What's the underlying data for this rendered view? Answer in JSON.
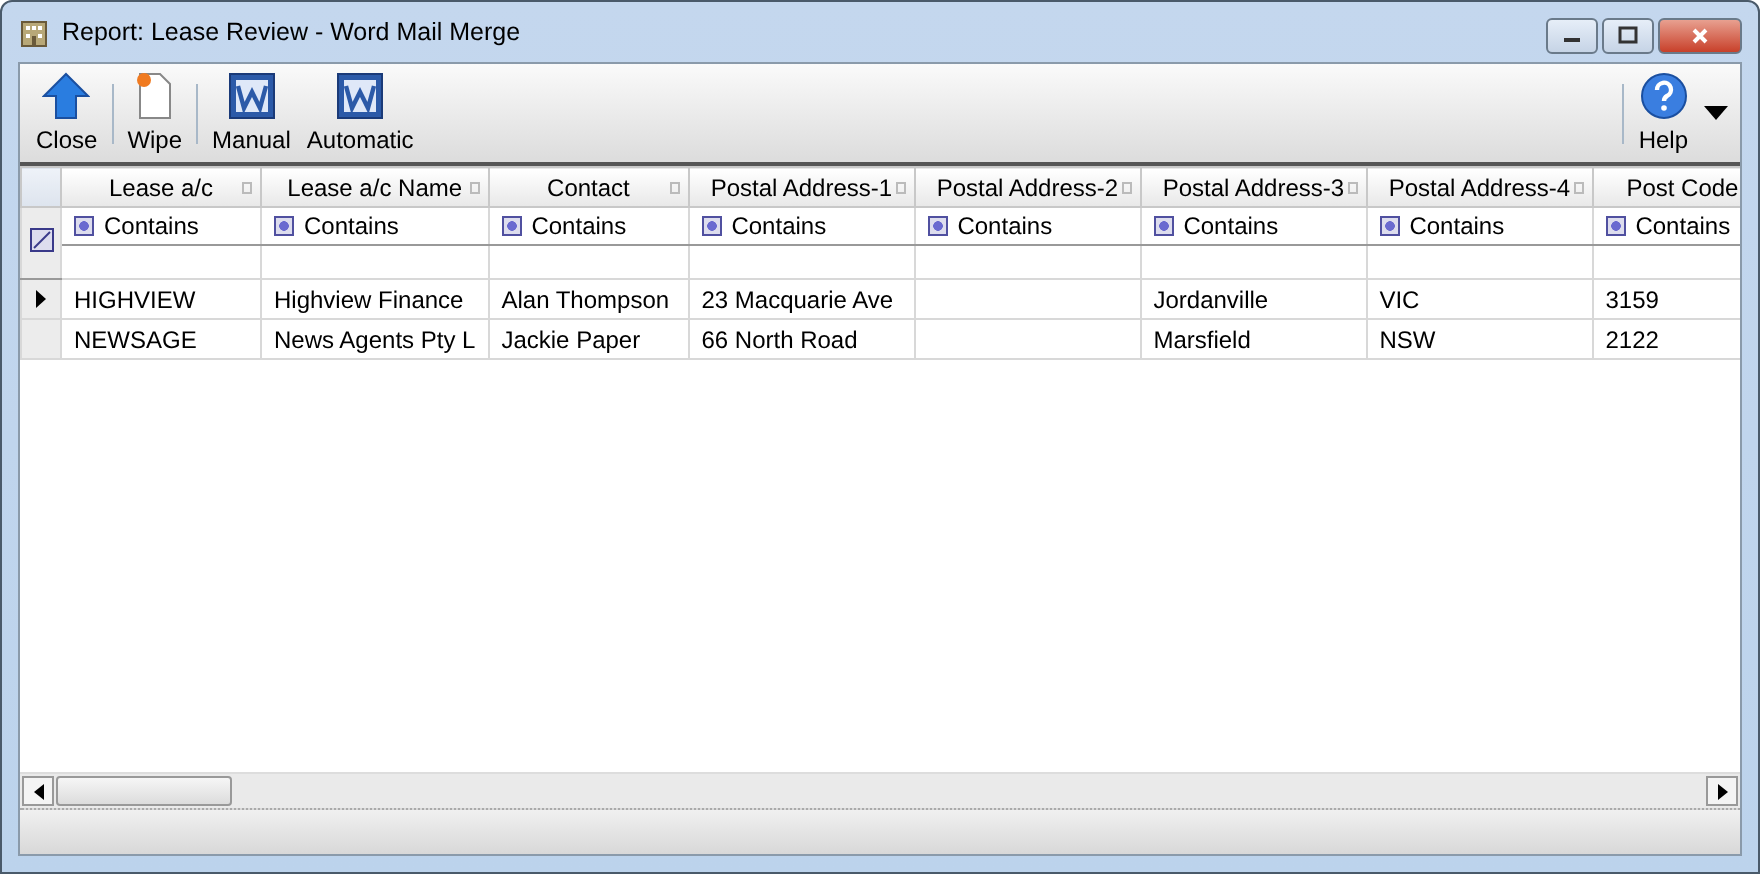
{
  "window": {
    "title": "Report: Lease Review - Word Mail Merge"
  },
  "toolbar": [
    {
      "label": "Close",
      "kind": "up"
    },
    {
      "label": "Wipe",
      "kind": "page"
    },
    {
      "label": "Manual",
      "kind": "word"
    },
    {
      "label": "Automatic",
      "kind": "word"
    }
  ],
  "help": {
    "label": "Help"
  },
  "table": {
    "columns": [
      "Lease a/c",
      "Lease a/c Name",
      "Contact",
      "Postal Address-1",
      "Postal Address-2",
      "Postal Address-3",
      "Postal Address-4",
      "Post Code"
    ],
    "filters": [
      "Contains",
      "Contains",
      "Contains",
      "Contains",
      "Contains",
      "Contains",
      "Contains",
      "Contains"
    ],
    "rows": [
      {
        "current": true,
        "cells": [
          "HIGHVIEW",
          "Highview Finance",
          "Alan Thompson",
          "23 Macquarie Ave",
          "",
          "Jordanville",
          "VIC",
          "3159"
        ]
      },
      {
        "current": false,
        "cells": [
          "NEWSAGE",
          "News Agents Pty L",
          "Jackie Paper",
          "66 North Road",
          "",
          "Marsfield",
          "NSW",
          "2122"
        ]
      }
    ]
  }
}
